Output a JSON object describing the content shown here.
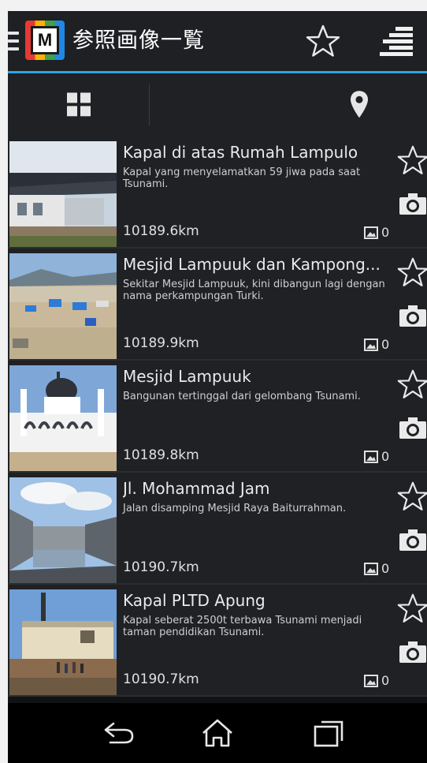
{
  "app": {
    "title": "参照画像一覧",
    "logo_letter": "M"
  },
  "tabs": [
    {
      "name": "grid-view",
      "icon": "grid-icon",
      "selected": false
    },
    {
      "name": "list-view",
      "icon": "list-icon",
      "selected": true
    },
    {
      "name": "map-view",
      "icon": "map-pin-icon",
      "selected": false
    }
  ],
  "items": [
    {
      "name": "Kapal di atas Rumah Lampulo",
      "description": "Kapal yang menyelamatkan 59 jiwa pada saat Tsunami.",
      "distance": "10189.6km",
      "photo_count": "0"
    },
    {
      "name": "Mesjid Lampuuk dan Kampong...",
      "description": "Sekitar Mesjid Lampuuk, kini dibangun lagi dengan nama perkampungan Turki.",
      "distance": "10189.9km",
      "photo_count": "0"
    },
    {
      "name": "Mesjid Lampuuk",
      "description": "Bangunan tertinggal dari gelombang Tsunami.",
      "distance": "10189.8km",
      "photo_count": "0"
    },
    {
      "name": "Jl. Mohammad Jam",
      "description": "Jalan disamping Mesjid Raya Baiturrahman.",
      "distance": "10190.7km",
      "photo_count": "0"
    },
    {
      "name": "Kapal PLTD Apung",
      "description": "Kapal seberat 2500t terbawa Tsunami menjadi taman pendidikan Tsunami.",
      "distance": "10190.7km",
      "photo_count": "0"
    }
  ],
  "colors": {
    "accent": "#29a7df",
    "background": "#1f2124",
    "text": "#eaeaea"
  }
}
